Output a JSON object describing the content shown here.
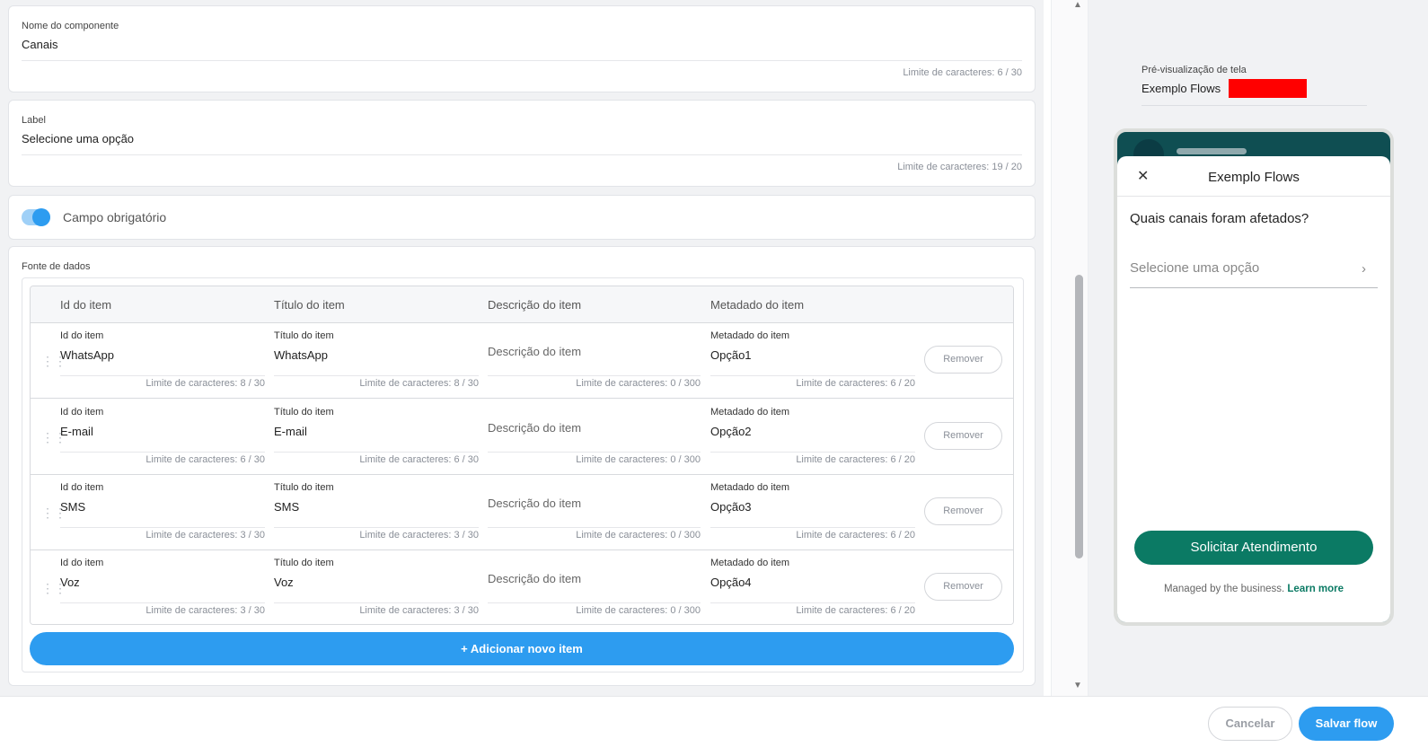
{
  "component_name": {
    "label": "Nome do componente",
    "value": "Canais",
    "limit": "Limite de caracteres: 6 / 30"
  },
  "label_field": {
    "label": "Label",
    "value": "Selecione uma opção",
    "limit": "Limite de caracteres: 19 / 20"
  },
  "required": {
    "label": "Campo obrigatório",
    "on": true
  },
  "data_source": {
    "title": "Fonte de dados",
    "headers": [
      "Id do item",
      "Título do item",
      "Descrição do item",
      "Metadado do item"
    ],
    "rows": [
      {
        "id_label": "Id do item",
        "id": "WhatsApp",
        "id_limit": "Limite de caracteres: 8 / 30",
        "title_label": "Título do item",
        "title": "WhatsApp",
        "title_limit": "Limite de caracteres: 8 / 30",
        "desc_placeholder": "Descrição do item",
        "desc_limit": "Limite de caracteres: 0 / 300",
        "meta_label": "Metadado do item",
        "meta": "Opção1",
        "meta_limit": "Limite de caracteres: 6 / 20",
        "remove": "Remover"
      },
      {
        "id_label": "Id do item",
        "id": "E-mail",
        "id_limit": "Limite de caracteres: 6 / 30",
        "title_label": "Título do item",
        "title": "E-mail",
        "title_limit": "Limite de caracteres: 6 / 30",
        "desc_placeholder": "Descrição do item",
        "desc_limit": "Limite de caracteres: 0 / 300",
        "meta_label": "Metadado do item",
        "meta": "Opção2",
        "meta_limit": "Limite de caracteres: 6 / 20",
        "remove": "Remover"
      },
      {
        "id_label": "Id do item",
        "id": "SMS",
        "id_limit": "Limite de caracteres: 3 / 30",
        "title_label": "Título do item",
        "title": "SMS",
        "title_limit": "Limite de caracteres: 3 / 30",
        "desc_placeholder": "Descrição do item",
        "desc_limit": "Limite de caracteres: 0 / 300",
        "meta_label": "Metadado do item",
        "meta": "Opção3",
        "meta_limit": "Limite de caracteres: 6 / 20",
        "remove": "Remover"
      },
      {
        "id_label": "Id do item",
        "id": "Voz",
        "id_limit": "Limite de caracteres: 3 / 30",
        "title_label": "Título do item",
        "title": "Voz",
        "title_limit": "Limite de caracteres: 3 / 30",
        "desc_placeholder": "Descrição do item",
        "desc_limit": "Limite de caracteres: 0 / 300",
        "meta_label": "Metadado do item",
        "meta": "Opção4",
        "meta_limit": "Limite de caracteres: 6 / 20",
        "remove": "Remover"
      }
    ],
    "add_button": "+  Adicionar novo item"
  },
  "preview": {
    "label": "Pré-visualização de tela",
    "name": "Exemplo Flows",
    "sheet_title": "Exemplo Flows",
    "close_icon": "close-icon",
    "question": "Quais canais foram afetados?",
    "select_placeholder": "Selecione uma opção",
    "cta": "Solicitar Atendimento",
    "footer_text": "Managed by the business.",
    "footer_link": "Learn more"
  },
  "footer": {
    "cancel": "Cancelar",
    "save": "Salvar flow"
  },
  "colors": {
    "primary": "#2d9cf0",
    "whatsapp_green": "#0b7a64",
    "whatsapp_header": "#0f4e52",
    "redaction": "#ff0000"
  }
}
